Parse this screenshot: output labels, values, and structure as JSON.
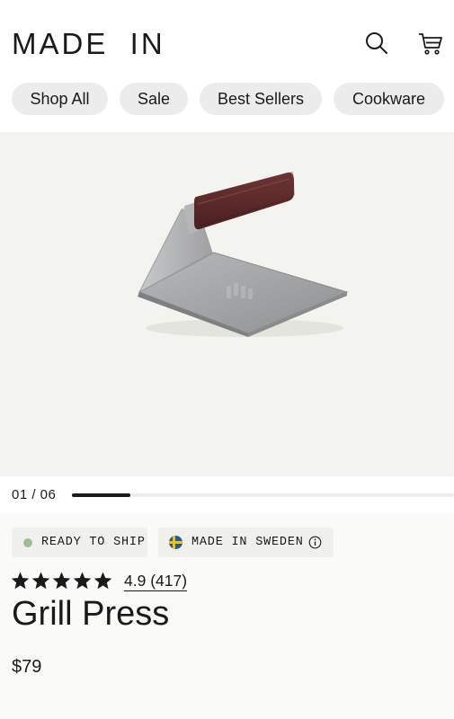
{
  "header": {
    "logo": "MADE  IN",
    "search_icon": "search-icon",
    "cart_icon": "cart-icon"
  },
  "nav": {
    "items": [
      {
        "label": "Shop All"
      },
      {
        "label": "Sale"
      },
      {
        "label": "Best Sellers"
      },
      {
        "label": "Cookware"
      }
    ]
  },
  "gallery": {
    "counter": "01 / 06",
    "current": 1,
    "total": 6,
    "image_icon": "grill-press-product-image"
  },
  "badges": {
    "shipping": "READY TO SHIP",
    "origin": "MADE IN SWEDEN",
    "origin_flag": "sweden-flag-icon",
    "info_icon": "info-icon"
  },
  "product": {
    "rating_text": "4.9 (417)",
    "rating_value": 4.9,
    "rating_max": 5,
    "review_count": 417,
    "name": "Grill Press",
    "price": "$79"
  },
  "colors": {
    "status_dot": "#9bbf94",
    "handle": "#5b2a2a"
  }
}
